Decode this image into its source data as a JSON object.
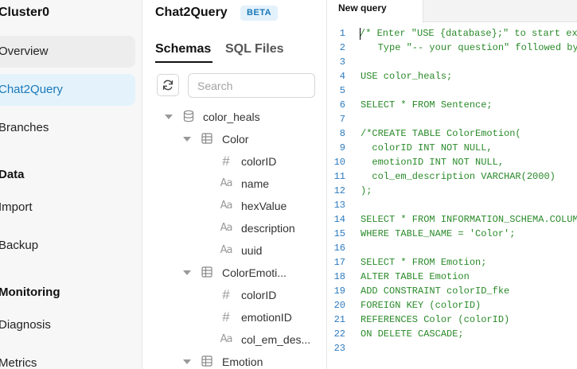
{
  "nav": {
    "cluster_name": "Cluster0",
    "items": [
      {
        "label": "Overview"
      },
      {
        "label": "Chat2Query"
      },
      {
        "label": "Branches"
      }
    ],
    "section_data": "Data",
    "data_items": [
      {
        "label": "Import"
      },
      {
        "label": "Backup"
      }
    ],
    "section_monitoring": "Monitoring",
    "monitoring_items": [
      {
        "label": "Diagnosis"
      },
      {
        "label": "Metrics"
      }
    ]
  },
  "schema": {
    "title": "Chat2Query",
    "badge": "BETA",
    "tabs": [
      {
        "label": "Schemas"
      },
      {
        "label": "SQL Files"
      }
    ],
    "search_placeholder": "Search",
    "tree": {
      "database": "color_heals",
      "tables": [
        {
          "name": "Color",
          "columns": [
            {
              "name": "colorID",
              "type_icon": "hash-icon"
            },
            {
              "name": "name",
              "type_icon": "text-icon"
            },
            {
              "name": "hexValue",
              "type_icon": "text-icon"
            },
            {
              "name": "description",
              "type_icon": "text-icon"
            },
            {
              "name": "uuid",
              "type_icon": "text-icon"
            }
          ]
        },
        {
          "name": "ColorEmoti...",
          "columns": [
            {
              "name": "colorID",
              "type_icon": "hash-icon"
            },
            {
              "name": "emotionID",
              "type_icon": "hash-icon"
            },
            {
              "name": "col_em_des...",
              "type_icon": "text-icon"
            }
          ]
        },
        {
          "name": "Emotion",
          "columns": []
        }
      ]
    }
  },
  "editor": {
    "tab_label": "New query",
    "lines": [
      "/* Enter \"USE {database};\" to start exp",
      "   Type \"-- your question\" followed by",
      "",
      "USE color_heals;",
      "",
      "SELECT * FROM Sentence;",
      "",
      "/*CREATE TABLE ColorEmotion(",
      "  colorID INT NOT NULL,",
      "  emotionID INT NOT NULL,",
      "  col_em_description VARCHAR(2000)",
      ");",
      "",
      "SELECT * FROM INFORMATION_SCHEMA.COLUMN",
      "WHERE TABLE_NAME = 'Color';",
      "",
      "SELECT * FROM Emotion;",
      "ALTER TABLE Emotion",
      "ADD CONSTRAINT colorID_fke",
      "FOREIGN KEY (colorID)",
      "REFERENCES Color (colorID)",
      "ON DELETE CASCADE;",
      ""
    ]
  },
  "colors": {
    "accent": "#1a78b9",
    "code_green": "#2a8a2a",
    "line_number_blue": "#2d7bbf"
  }
}
